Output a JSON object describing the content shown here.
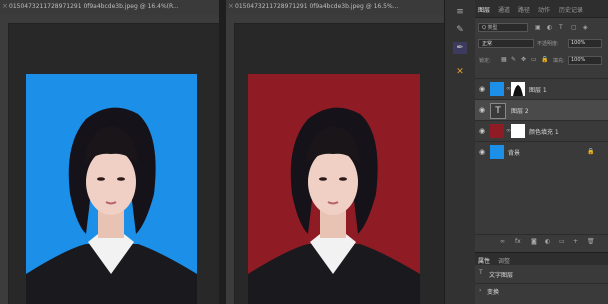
{
  "documents": [
    {
      "title": "0150473211728971291 0f9a4bcde3b.jpeg @ 16.4%(R..."
    },
    {
      "title": "0150473211728971291 0f9a4bcde3b.jpeg @ 16.5%..."
    }
  ],
  "panel_tabs": [
    "图层",
    "通道",
    "路径",
    "动作",
    "历史记录"
  ],
  "filter": {
    "label": "Q 类型"
  },
  "blend": {
    "mode": "正常",
    "opacity_label": "不透明度:",
    "opacity": "100%"
  },
  "lock": {
    "label": "锁定:",
    "fill_label": "填充:",
    "fill": "100%"
  },
  "layers": [
    {
      "name": "图层 1"
    },
    {
      "name": "图层 2"
    },
    {
      "name": "颜色填充 1"
    },
    {
      "name": "背景"
    }
  ],
  "properties": {
    "tabs": [
      "属性",
      "调整"
    ],
    "type_label": "文字图层",
    "transform_label": "变换"
  },
  "colors": {
    "blue_bg": "#1c8fe8",
    "red_bg": "#8f1c24"
  }
}
